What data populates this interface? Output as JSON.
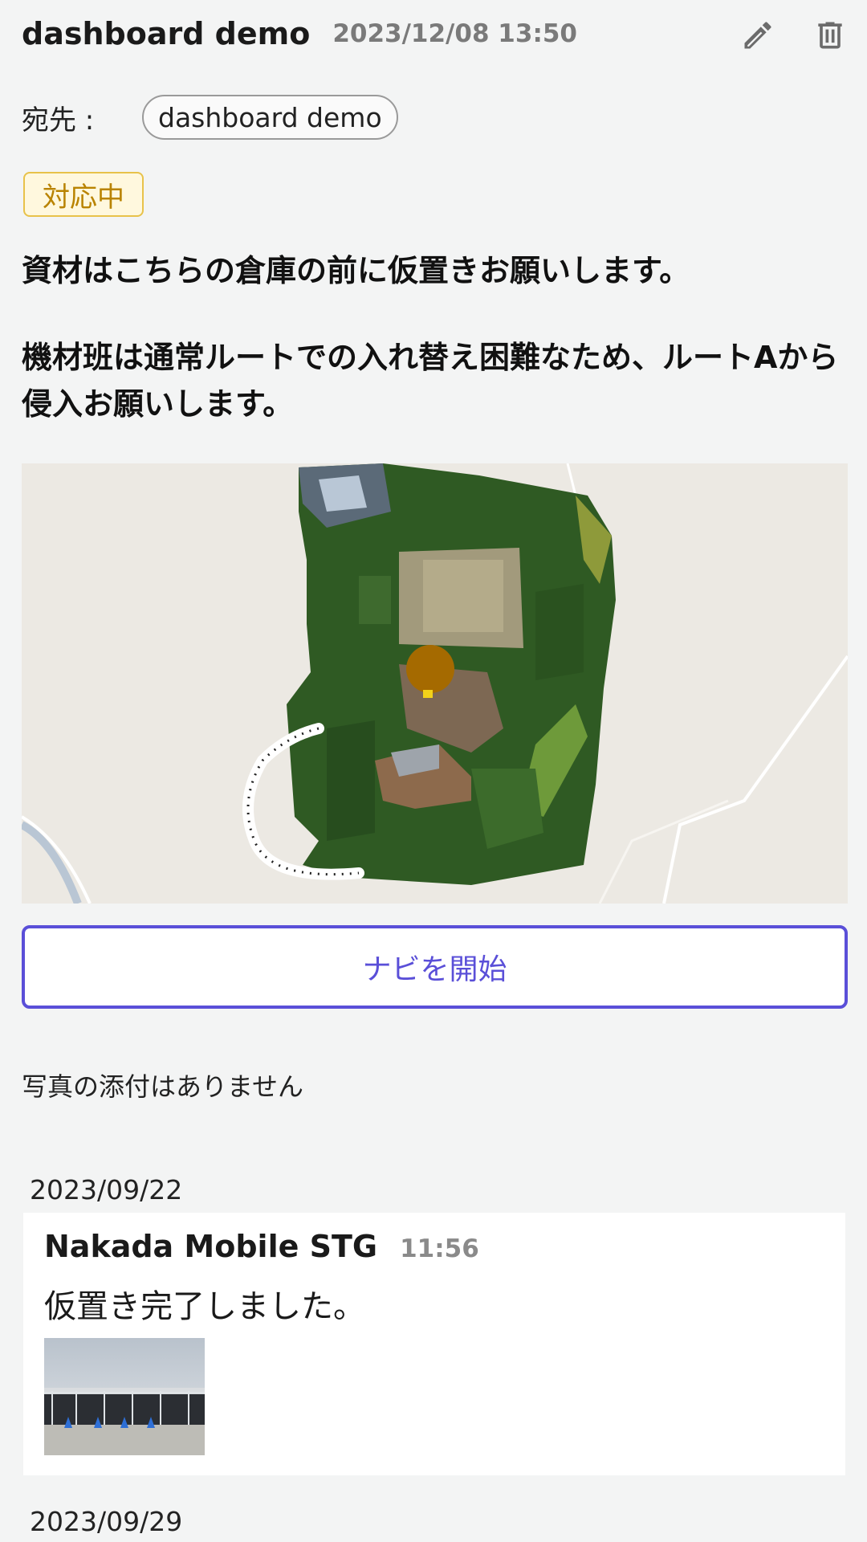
{
  "header": {
    "author": "dashboard demo",
    "datetime": "2023/12/08 13:50",
    "edit_icon": "pencil-icon",
    "delete_icon": "trash-icon"
  },
  "recipient": {
    "label": "宛先 :",
    "chip": "dashboard demo"
  },
  "status": {
    "label": "対応中",
    "color": "#b98300"
  },
  "message": {
    "line1": "資材はこちらの倉庫の前に仮置きお願いします。",
    "line2": "機材班は通常ルートでの入れ替え困難なため、ルートAから侵入お願いします。"
  },
  "navi_button": {
    "label": "ナビを開始",
    "color": "#5a4fd8"
  },
  "attachments": {
    "empty_text": "写真の添付はありません"
  },
  "comments": [
    {
      "date": "2023/09/22",
      "author": "Nakada Mobile STG",
      "time": "11:56",
      "text": "仮置き完了しました。"
    },
    {
      "date": "2023/09/29"
    }
  ]
}
